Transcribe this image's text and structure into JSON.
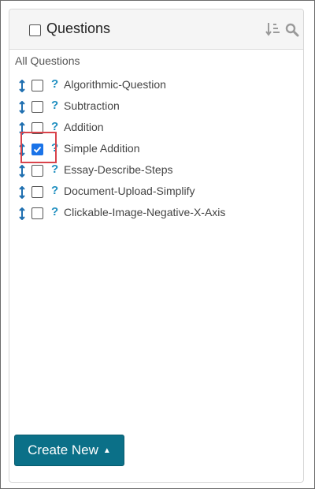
{
  "header": {
    "title": "Questions",
    "icons": [
      "sort-icon",
      "search-icon"
    ]
  },
  "list": {
    "group_label": "All Questions",
    "items": [
      {
        "label": "Algorithmic-Question",
        "checked": false
      },
      {
        "label": "Subtraction",
        "checked": false
      },
      {
        "label": "Addition",
        "checked": false
      },
      {
        "label": "Simple Addition",
        "checked": true
      },
      {
        "label": "Essay-Describe-Steps",
        "checked": false
      },
      {
        "label": "Document-Upload-Simplify",
        "checked": false
      },
      {
        "label": "Clickable-Image-Negative-X-Axis",
        "checked": false
      }
    ]
  },
  "footer": {
    "create_label": "Create New"
  },
  "colors": {
    "accent": "#0b7088",
    "help_icon": "#1f8fc0",
    "highlight": "#d9434b",
    "checked": "#1a73e8"
  }
}
